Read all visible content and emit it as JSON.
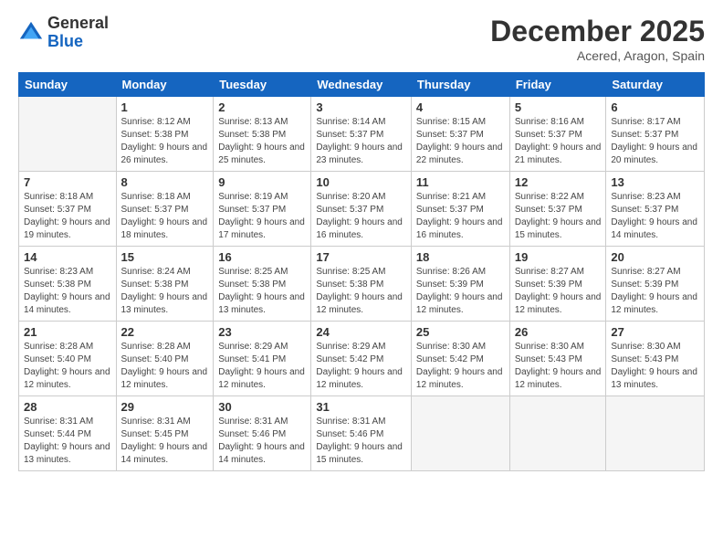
{
  "logo": {
    "general": "General",
    "blue": "Blue"
  },
  "title": "December 2025",
  "subtitle": "Acered, Aragon, Spain",
  "days_header": [
    "Sunday",
    "Monday",
    "Tuesday",
    "Wednesday",
    "Thursday",
    "Friday",
    "Saturday"
  ],
  "weeks": [
    [
      {
        "num": "",
        "sunrise": "",
        "sunset": "",
        "daylight": ""
      },
      {
        "num": "1",
        "sunrise": "Sunrise: 8:12 AM",
        "sunset": "Sunset: 5:38 PM",
        "daylight": "Daylight: 9 hours and 26 minutes."
      },
      {
        "num": "2",
        "sunrise": "Sunrise: 8:13 AM",
        "sunset": "Sunset: 5:38 PM",
        "daylight": "Daylight: 9 hours and 25 minutes."
      },
      {
        "num": "3",
        "sunrise": "Sunrise: 8:14 AM",
        "sunset": "Sunset: 5:37 PM",
        "daylight": "Daylight: 9 hours and 23 minutes."
      },
      {
        "num": "4",
        "sunrise": "Sunrise: 8:15 AM",
        "sunset": "Sunset: 5:37 PM",
        "daylight": "Daylight: 9 hours and 22 minutes."
      },
      {
        "num": "5",
        "sunrise": "Sunrise: 8:16 AM",
        "sunset": "Sunset: 5:37 PM",
        "daylight": "Daylight: 9 hours and 21 minutes."
      },
      {
        "num": "6",
        "sunrise": "Sunrise: 8:17 AM",
        "sunset": "Sunset: 5:37 PM",
        "daylight": "Daylight: 9 hours and 20 minutes."
      }
    ],
    [
      {
        "num": "7",
        "sunrise": "Sunrise: 8:18 AM",
        "sunset": "Sunset: 5:37 PM",
        "daylight": "Daylight: 9 hours and 19 minutes."
      },
      {
        "num": "8",
        "sunrise": "Sunrise: 8:18 AM",
        "sunset": "Sunset: 5:37 PM",
        "daylight": "Daylight: 9 hours and 18 minutes."
      },
      {
        "num": "9",
        "sunrise": "Sunrise: 8:19 AM",
        "sunset": "Sunset: 5:37 PM",
        "daylight": "Daylight: 9 hours and 17 minutes."
      },
      {
        "num": "10",
        "sunrise": "Sunrise: 8:20 AM",
        "sunset": "Sunset: 5:37 PM",
        "daylight": "Daylight: 9 hours and 16 minutes."
      },
      {
        "num": "11",
        "sunrise": "Sunrise: 8:21 AM",
        "sunset": "Sunset: 5:37 PM",
        "daylight": "Daylight: 9 hours and 16 minutes."
      },
      {
        "num": "12",
        "sunrise": "Sunrise: 8:22 AM",
        "sunset": "Sunset: 5:37 PM",
        "daylight": "Daylight: 9 hours and 15 minutes."
      },
      {
        "num": "13",
        "sunrise": "Sunrise: 8:23 AM",
        "sunset": "Sunset: 5:37 PM",
        "daylight": "Daylight: 9 hours and 14 minutes."
      }
    ],
    [
      {
        "num": "14",
        "sunrise": "Sunrise: 8:23 AM",
        "sunset": "Sunset: 5:38 PM",
        "daylight": "Daylight: 9 hours and 14 minutes."
      },
      {
        "num": "15",
        "sunrise": "Sunrise: 8:24 AM",
        "sunset": "Sunset: 5:38 PM",
        "daylight": "Daylight: 9 hours and 13 minutes."
      },
      {
        "num": "16",
        "sunrise": "Sunrise: 8:25 AM",
        "sunset": "Sunset: 5:38 PM",
        "daylight": "Daylight: 9 hours and 13 minutes."
      },
      {
        "num": "17",
        "sunrise": "Sunrise: 8:25 AM",
        "sunset": "Sunset: 5:38 PM",
        "daylight": "Daylight: 9 hours and 12 minutes."
      },
      {
        "num": "18",
        "sunrise": "Sunrise: 8:26 AM",
        "sunset": "Sunset: 5:39 PM",
        "daylight": "Daylight: 9 hours and 12 minutes."
      },
      {
        "num": "19",
        "sunrise": "Sunrise: 8:27 AM",
        "sunset": "Sunset: 5:39 PM",
        "daylight": "Daylight: 9 hours and 12 minutes."
      },
      {
        "num": "20",
        "sunrise": "Sunrise: 8:27 AM",
        "sunset": "Sunset: 5:39 PM",
        "daylight": "Daylight: 9 hours and 12 minutes."
      }
    ],
    [
      {
        "num": "21",
        "sunrise": "Sunrise: 8:28 AM",
        "sunset": "Sunset: 5:40 PM",
        "daylight": "Daylight: 9 hours and 12 minutes."
      },
      {
        "num": "22",
        "sunrise": "Sunrise: 8:28 AM",
        "sunset": "Sunset: 5:40 PM",
        "daylight": "Daylight: 9 hours and 12 minutes."
      },
      {
        "num": "23",
        "sunrise": "Sunrise: 8:29 AM",
        "sunset": "Sunset: 5:41 PM",
        "daylight": "Daylight: 9 hours and 12 minutes."
      },
      {
        "num": "24",
        "sunrise": "Sunrise: 8:29 AM",
        "sunset": "Sunset: 5:42 PM",
        "daylight": "Daylight: 9 hours and 12 minutes."
      },
      {
        "num": "25",
        "sunrise": "Sunrise: 8:30 AM",
        "sunset": "Sunset: 5:42 PM",
        "daylight": "Daylight: 9 hours and 12 minutes."
      },
      {
        "num": "26",
        "sunrise": "Sunrise: 8:30 AM",
        "sunset": "Sunset: 5:43 PM",
        "daylight": "Daylight: 9 hours and 12 minutes."
      },
      {
        "num": "27",
        "sunrise": "Sunrise: 8:30 AM",
        "sunset": "Sunset: 5:43 PM",
        "daylight": "Daylight: 9 hours and 13 minutes."
      }
    ],
    [
      {
        "num": "28",
        "sunrise": "Sunrise: 8:31 AM",
        "sunset": "Sunset: 5:44 PM",
        "daylight": "Daylight: 9 hours and 13 minutes."
      },
      {
        "num": "29",
        "sunrise": "Sunrise: 8:31 AM",
        "sunset": "Sunset: 5:45 PM",
        "daylight": "Daylight: 9 hours and 14 minutes."
      },
      {
        "num": "30",
        "sunrise": "Sunrise: 8:31 AM",
        "sunset": "Sunset: 5:46 PM",
        "daylight": "Daylight: 9 hours and 14 minutes."
      },
      {
        "num": "31",
        "sunrise": "Sunrise: 8:31 AM",
        "sunset": "Sunset: 5:46 PM",
        "daylight": "Daylight: 9 hours and 15 minutes."
      },
      {
        "num": "",
        "sunrise": "",
        "sunset": "",
        "daylight": ""
      },
      {
        "num": "",
        "sunrise": "",
        "sunset": "",
        "daylight": ""
      },
      {
        "num": "",
        "sunrise": "",
        "sunset": "",
        "daylight": ""
      }
    ]
  ]
}
